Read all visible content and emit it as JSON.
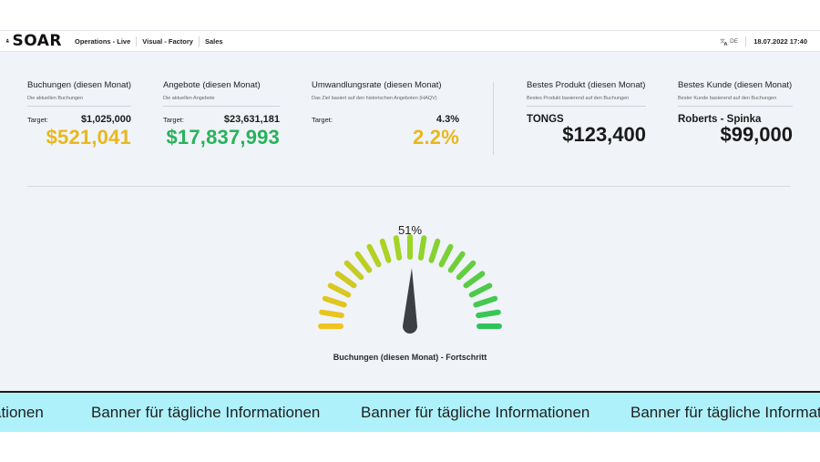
{
  "header": {
    "logo_text": "SOAR",
    "nav": [
      "Operations - Live",
      "Visual - Factory",
      "Sales"
    ],
    "language": "DE",
    "datetime": "18.07.2022 17:40"
  },
  "kpis": [
    {
      "title": "Buchungen (diesen Monat)",
      "subtitle": "Die aktuellen Buchungen",
      "target_label": "Target:",
      "target": "$1,025,000",
      "value": "$521,041",
      "value_color": "#e8b81c"
    },
    {
      "title": "Angebote (diesen Monat)",
      "subtitle": "Die aktuellen Angebote",
      "target_label": "Target:",
      "target": "$23,631,181",
      "value": "$17,837,993",
      "value_color": "#27b35a"
    },
    {
      "title": "Umwandlungsrate (diesen Monat)",
      "subtitle": "Das Ziel basiert auf den historischen Angeboten (HAQV)",
      "target_label": "Target:",
      "target": "4.3%",
      "value": "2.2%",
      "value_color": "#e8b81c"
    }
  ],
  "best": [
    {
      "title": "Bestes Produkt (diesen Monat)",
      "subtitle": "Bestes Produkt basierend auf den Buchungen",
      "name": "TONGS",
      "value": "$123,400"
    },
    {
      "title": "Bestes Kunde (diesen Monat)",
      "subtitle": "Bester Kunde basierend auf den Buchungen",
      "name": "Roberts - Spinka",
      "value": "$99,000"
    }
  ],
  "gauge": {
    "percent_label": "51%",
    "value": 0.51,
    "caption": "Buchungen (diesen Monat) - Fortschritt",
    "colors": {
      "low": "#f2c21e",
      "high": "#2ec45a",
      "needle": "#3d3f42"
    }
  },
  "banner": {
    "text": "Banner für tägliche Informationen",
    "partial_start": "ationen",
    "partial_end": "Banner für tägliche Informat"
  }
}
